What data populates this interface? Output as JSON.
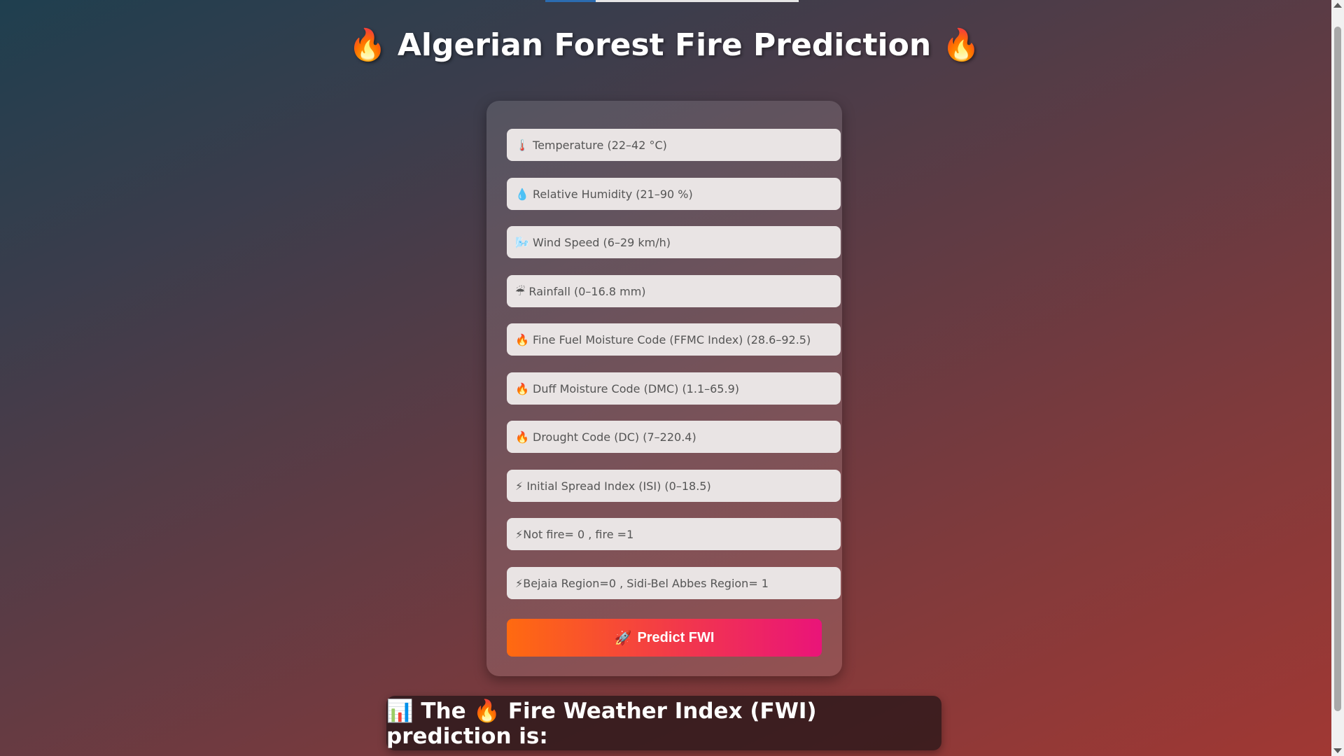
{
  "page": {
    "title": "🔥 Algerian Forest Fire Prediction 🔥",
    "loading_progress": 0.2
  },
  "form": {
    "fields": [
      {
        "name": "temperature",
        "placeholder": "🌡️ Temperature (22–42 °C)",
        "value": ""
      },
      {
        "name": "rh",
        "placeholder": "💧 Relative Humidity (21–90 %)",
        "value": ""
      },
      {
        "name": "ws",
        "placeholder": "🌬️ Wind Speed (6–29 km/h)",
        "value": ""
      },
      {
        "name": "rain",
        "placeholder": "☔ Rainfall (0–16.8 mm)",
        "value": ""
      },
      {
        "name": "ffmc",
        "placeholder": "🔥 Fine Fuel Moisture Code (FFMC Index) (28.6–92.5)",
        "value": ""
      },
      {
        "name": "dmc",
        "placeholder": "🔥 Duff Moisture Code (DMC) (1.1–65.9)",
        "value": ""
      },
      {
        "name": "dc",
        "placeholder": "🔥 Drought Code (DC) (7–220.4)",
        "value": ""
      },
      {
        "name": "isi",
        "placeholder": "⚡ Initial Spread Index (ISI) (0–18.5)",
        "value": ""
      },
      {
        "name": "classes",
        "placeholder": "⚡Not fire= 0 , fire =1",
        "value": ""
      },
      {
        "name": "region",
        "placeholder": "⚡Bejaia Region=0 , Sidi-Bel Abbes Region= 1",
        "value": ""
      }
    ],
    "submit": {
      "icon": "🚀",
      "label": "Predict FWI"
    }
  },
  "result": {
    "text": "📊 The 🔥 Fire Weather Index (FWI) prediction is:"
  },
  "colors": {
    "button_gradient_start": "#ff6a10",
    "button_gradient_end": "#ea1479",
    "field_background": "#e9e4e4"
  }
}
